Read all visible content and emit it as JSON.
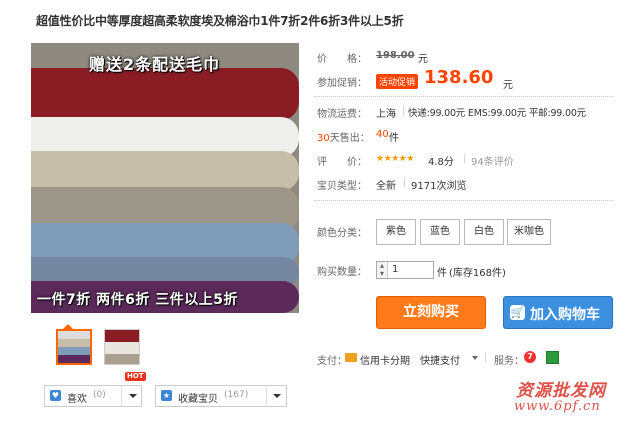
{
  "title": "超值性价比中等厚度超高柔软度埃及棉浴巾1件7折2件6折3件以上5折",
  "photo": {
    "caption_top": "赠送2条配送毛巾",
    "caption_bottom": "一件7折 两件6折 三件以上5折",
    "band_colors": [
      "#8a1c24",
      "#efefef",
      "#c9c0ad",
      "#a09a8c",
      "#7f9cb8",
      "#7a8aa0",
      "#5e2a5e"
    ]
  },
  "price": {
    "label": "价　　格：",
    "original": "198.00",
    "unit": "元"
  },
  "promo": {
    "label": "参加促销：",
    "badge": "活动促销",
    "price": "138.60",
    "unit": "元"
  },
  "shipping": {
    "label": "物流运费：",
    "from": "上海",
    "sep": "|",
    "detail": "快递:99.00元 EMS:99.00元 平邮:99.00元"
  },
  "sold": {
    "label_prefix": "30",
    "label_suffix": "天售出：",
    "count": "40",
    "unit": "件"
  },
  "rating": {
    "label": "评　　价：",
    "stars": "★★★★★",
    "score": "4.8分",
    "sep": "|",
    "reviews": "94条评价"
  },
  "item_type": {
    "label": "宝贝类型：",
    "value": "全新",
    "sep": "|",
    "views": "9171次浏览"
  },
  "color": {
    "label": "颜色分类：",
    "options": [
      "紫色",
      "蓝色",
      "白色",
      "米咖色"
    ]
  },
  "quantity": {
    "label": "购买数量：",
    "value": "1",
    "unit": "件",
    "stock": "(库存168件)"
  },
  "buttons": {
    "buy_now": "立刻购买",
    "add_to_cart": "加入购物车"
  },
  "payment": {
    "label": "支付：",
    "credit": "信用卡分期",
    "quick": "快捷支付",
    "service_label": "服务："
  },
  "favorites": {
    "like_label": "喜欢",
    "like_count": "(0)",
    "hot": "HOT",
    "collect_label": "收藏宝贝",
    "collect_count": "(167)"
  },
  "watermark": {
    "cn": "资源批发网",
    "url": "www.6pf.cn"
  },
  "colors": {
    "accent": "#ff4400",
    "buy": "#ff7a1a",
    "cart": "#3d8fe0"
  }
}
